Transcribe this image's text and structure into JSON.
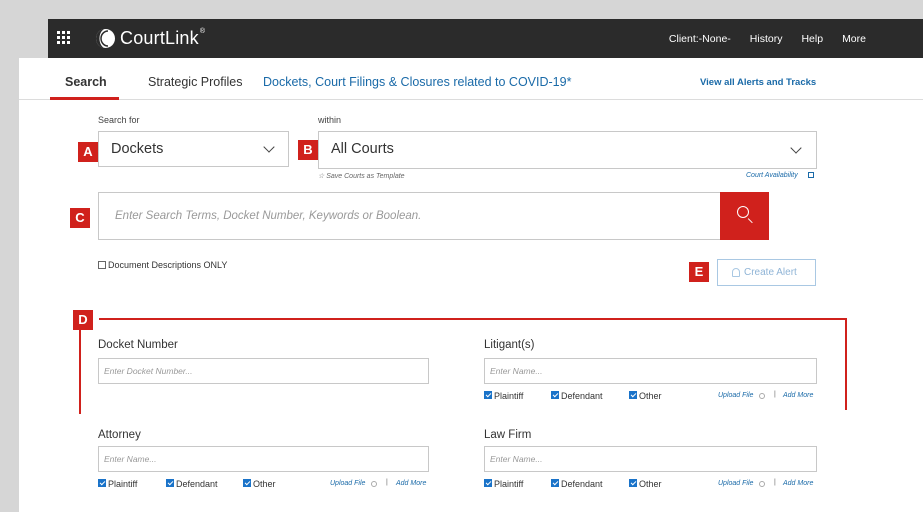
{
  "topbar": {
    "logo_text": "CourtLink",
    "logo_mark": "®",
    "nav": [
      "Client:-None-",
      "History",
      "Help",
      "More"
    ]
  },
  "tabs": {
    "search": "Search",
    "strategic": "Strategic Profiles",
    "covid": "Dockets, Court Filings & Closures related to COVID-19*",
    "view_all": "View all Alerts and Tracks"
  },
  "search_for": {
    "label": "Search for",
    "value": "Dockets"
  },
  "within": {
    "label": "within",
    "value": "All Courts",
    "save_template": "☆ Save Courts as Template",
    "court_availability": "Court Availability"
  },
  "search": {
    "placeholder": "Enter Search Terms, Docket Number, Keywords or Boolean."
  },
  "doc_desc_only": "Document Descriptions ONLY",
  "create_alert": "Create Alert",
  "badges": {
    "a": "A",
    "b": "B",
    "c": "C",
    "d": "D",
    "e": "E"
  },
  "docket_number": {
    "label": "Docket Number",
    "placeholder": "Enter Docket Number..."
  },
  "litigants": {
    "label": "Litigant(s)",
    "placeholder": "Enter Name...",
    "roles": [
      "Plaintiff",
      "Defendant",
      "Other"
    ],
    "upload": "Upload File",
    "add_more": "Add More"
  },
  "attorney": {
    "label": "Attorney",
    "placeholder": "Enter Name...",
    "roles": [
      "Plaintiff",
      "Defendant",
      "Other"
    ],
    "upload": "Upload File",
    "add_more": "Add More"
  },
  "law_firm": {
    "label": "Law Firm",
    "placeholder": "Enter Name...",
    "roles": [
      "Plaintiff",
      "Defendant",
      "Other"
    ],
    "upload": "Upload File",
    "add_more": "Add More"
  },
  "colors": {
    "accent_red": "#d0211c",
    "link_blue": "#1a6aa8",
    "topbar": "#2b2b2b"
  }
}
